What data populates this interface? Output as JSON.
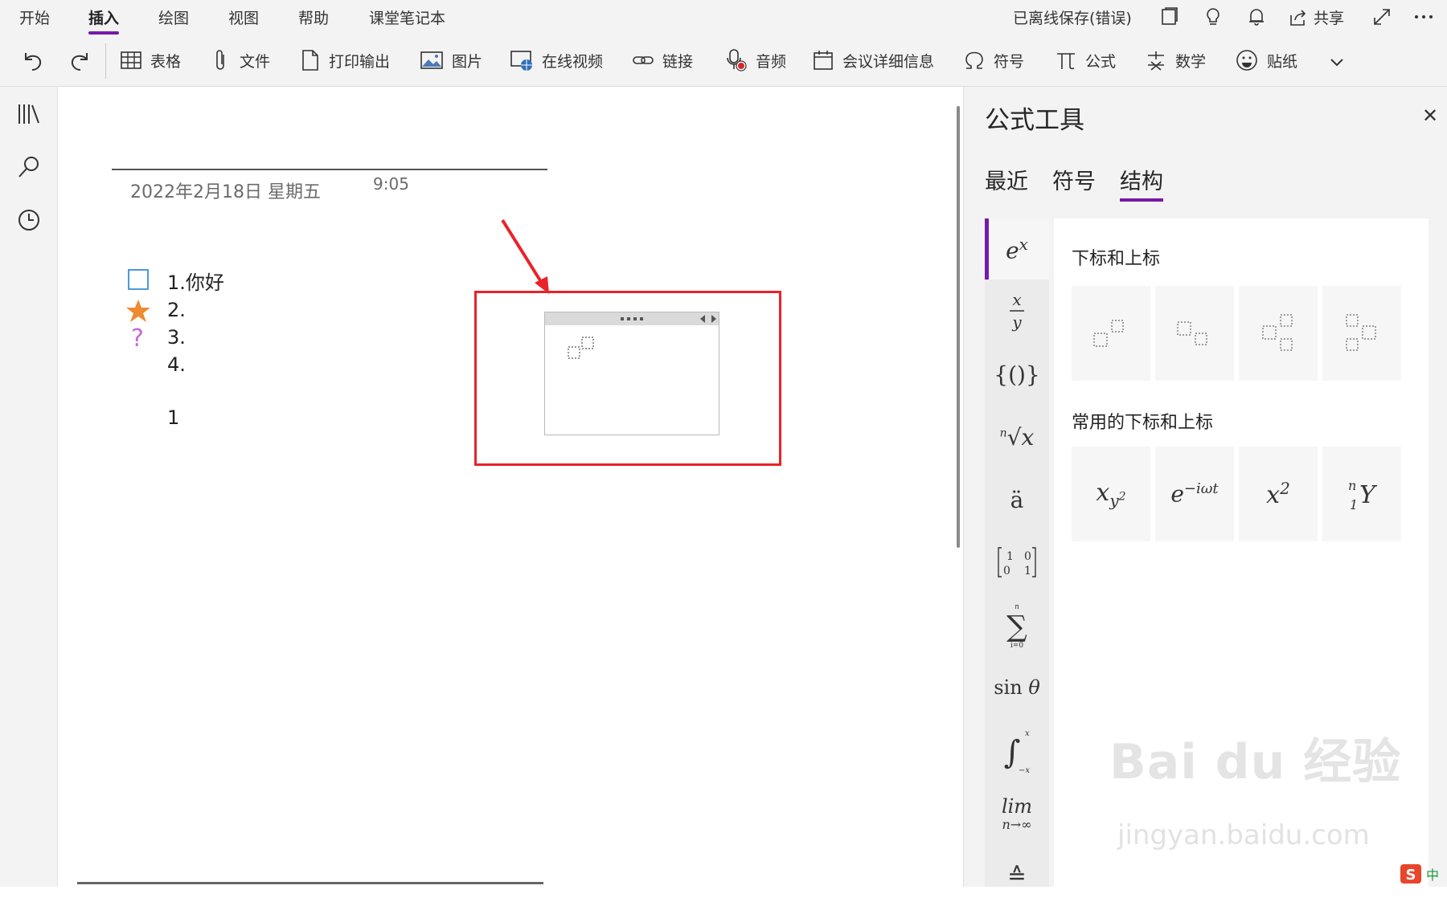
{
  "menu": {
    "tabs": [
      "开始",
      "插入",
      "绘图",
      "视图",
      "帮助",
      "课堂笔记本"
    ],
    "active_tab": "插入",
    "save_status": "已离线保存(错误)",
    "share_label": "共享"
  },
  "toolbar": {
    "table": "表格",
    "file": "文件",
    "printout": "打印输出",
    "picture": "图片",
    "online_video": "在线视频",
    "link": "链接",
    "audio": "音频",
    "meeting": "会议详细信息",
    "symbol": "符号",
    "equation": "公式",
    "math": "数学",
    "sticker": "贴纸"
  },
  "note": {
    "date": "2022年2月18日 星期五",
    "time": "9:05",
    "items": [
      "1.你好",
      "2.",
      "3.",
      "4.",
      "1"
    ]
  },
  "pane": {
    "title": "公式工具",
    "tabs": [
      "最近",
      "符号",
      "结构"
    ],
    "active_tab": "结构",
    "section1": "下标和上标",
    "section2": "常用的下标和上标",
    "categories": [
      "e^x",
      "x/y",
      "{()}",
      "ⁿ√x",
      "ä",
      "[1 0;0 1]",
      "Σ",
      "sin θ",
      "∫",
      "lim n→∞",
      "≙"
    ],
    "common_tiles": [
      "x_{y²}",
      "e^{−iωt}",
      "x²",
      "ⁿ₁Y"
    ]
  },
  "colors": {
    "accent": "#7719aa",
    "highlight": "#e8232a",
    "star": "#f08a30",
    "question": "#c46ad9",
    "checkbox": "#3a8fd1"
  },
  "watermark": {
    "logo": "Bai du 经验",
    "url": "jingyan.baidu.com"
  }
}
